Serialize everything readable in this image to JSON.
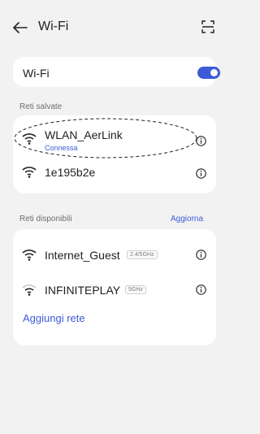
{
  "header": {
    "title": "Wi-Fi",
    "back_icon": "arrow-left-icon",
    "scan_icon": "qr-scan-icon"
  },
  "wifi_toggle": {
    "label": "Wi-Fi",
    "state": "on",
    "accent": "#3d5bd6"
  },
  "saved": {
    "section_label": "Reti salvate",
    "networks": [
      {
        "name": "WLAN_AerLink",
        "status": "Connessa"
      },
      {
        "name": "1e195b2e",
        "status": ""
      }
    ]
  },
  "available": {
    "section_label": "Reti disponibili",
    "refresh_label": "Aggiorna",
    "networks": [
      {
        "name": "Internet_Guest",
        "band": "2.4/5GHz"
      },
      {
        "name": "INFINITEPLAY",
        "band": "5GHz"
      }
    ],
    "add_label": "Aggiungi rete"
  }
}
